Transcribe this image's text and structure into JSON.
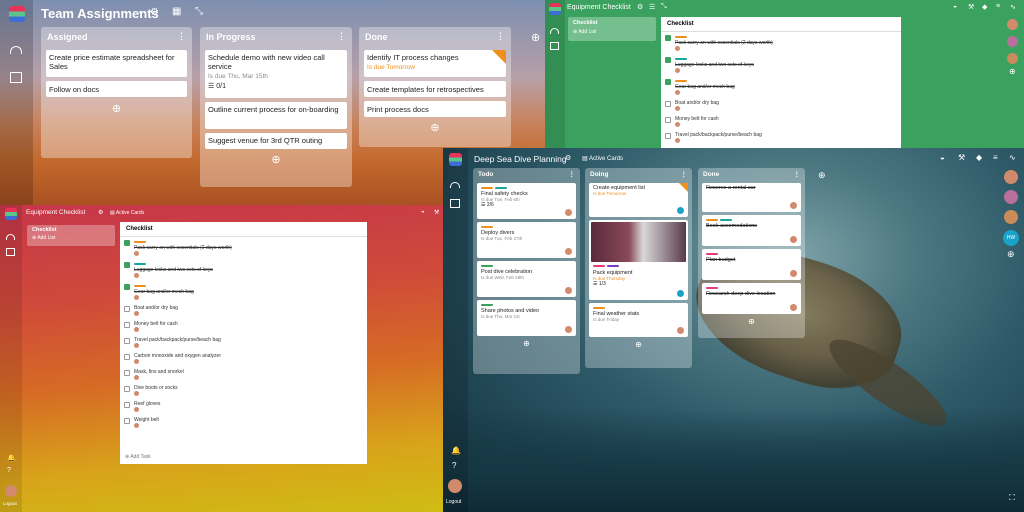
{
  "paneA": {
    "title": "Team Assignments",
    "lists": [
      {
        "name": "Assigned",
        "cards": [
          {
            "text": "Create price estimate spreadsheet for Sales"
          },
          {
            "text": "Follow on docs"
          }
        ]
      },
      {
        "name": "In Progress",
        "cards": [
          {
            "text": "Schedule demo with new video call service",
            "due": "Is due Thu, Mar 15th",
            "checklist": "0/1"
          },
          {
            "text": "Outline current process for on-boarding"
          },
          {
            "text": "Suggest venue for 3rd QTR outing"
          }
        ]
      },
      {
        "name": "Done",
        "cards": [
          {
            "text": "Identify IT process changes",
            "due": "Is due Tomorrow"
          },
          {
            "text": "Create templates for retrospectives"
          },
          {
            "text": "Print process docs"
          }
        ]
      }
    ]
  },
  "paneB": {
    "title": "Equipment Checklist",
    "list_name": "Checklist",
    "add_list": "Add List",
    "card_title": "Checklist",
    "items": [
      {
        "text": "Pack carry-on with essentials (2 days worth)",
        "done": true
      },
      {
        "text": "Luggage locks and two sets of keys",
        "done": true
      },
      {
        "text": "Gear bag and/or mesh bag",
        "done": true
      },
      {
        "text": "Boat and/or dry bag",
        "done": false
      },
      {
        "text": "Money belt for cash",
        "done": false
      },
      {
        "text": "Travel pack/backpack/purse/beach bag",
        "done": false
      }
    ]
  },
  "paneC": {
    "title": "Equipment Checklist",
    "active_cards": "Active Cards",
    "list_name": "Checklist",
    "add_list": "Add List",
    "card_title": "Checklist",
    "add_task": "Add Task",
    "logout": "Logout",
    "items": [
      {
        "text": "Pack carry-on with essentials (2 days worth)",
        "done": true
      },
      {
        "text": "Luggage locks and two sets of keys",
        "done": true
      },
      {
        "text": "Gear bag and/or mesh bag",
        "done": true
      },
      {
        "text": "Boat and/or dry bag",
        "done": false
      },
      {
        "text": "Money belt for cash",
        "done": false
      },
      {
        "text": "Travel pack/backpack/purse/beach bag",
        "done": false
      },
      {
        "text": "Carbon monoxide and oxygen analyzer",
        "done": false
      },
      {
        "text": "Mask, fins and snorkel",
        "done": false
      },
      {
        "text": "Dive boots or socks",
        "done": false
      },
      {
        "text": "Reef gloves",
        "done": false
      },
      {
        "text": "Weight belt",
        "done": false
      }
    ]
  },
  "paneD": {
    "title": "Deep Sea Dive Planning",
    "active_cards": "Active Cards",
    "logout": "Logout",
    "avatar_initials": "HW",
    "lists": [
      {
        "name": "Todo",
        "cards": [
          {
            "text": "Final safety checks",
            "due": "Is due Tue, Feb 6th",
            "checklist": "2/6"
          },
          {
            "text": "Deploy divers",
            "due": "Is due Tue, Feb 27th"
          },
          {
            "text": "Post dive celebration",
            "due": "Is due Wed, Feb 28th"
          },
          {
            "text": "Share photos and video",
            "due": "Is due Thu, Mar 1st"
          }
        ]
      },
      {
        "name": "Doing",
        "cards": [
          {
            "text": "Create equipment list",
            "due": "Is due Tomorrow"
          },
          {
            "text": "Pack equipment",
            "due": "Is due Thursday",
            "checklist": "1/3"
          },
          {
            "text": "Final weather stats",
            "due": "Is due Friday"
          }
        ]
      },
      {
        "name": "Done",
        "cards": [
          {
            "text": "Reserve a rental car"
          },
          {
            "text": "Book accomodations"
          },
          {
            "text": "Plan budget"
          },
          {
            "text": "Research deep dive location"
          }
        ]
      }
    ]
  },
  "colors": {
    "green": "#3aa25e",
    "orange": "#f0901c",
    "teal": "#1aa3a0",
    "blue": "#3b8fd6",
    "pink": "#e23d7a",
    "purple": "#7b3fc4"
  }
}
